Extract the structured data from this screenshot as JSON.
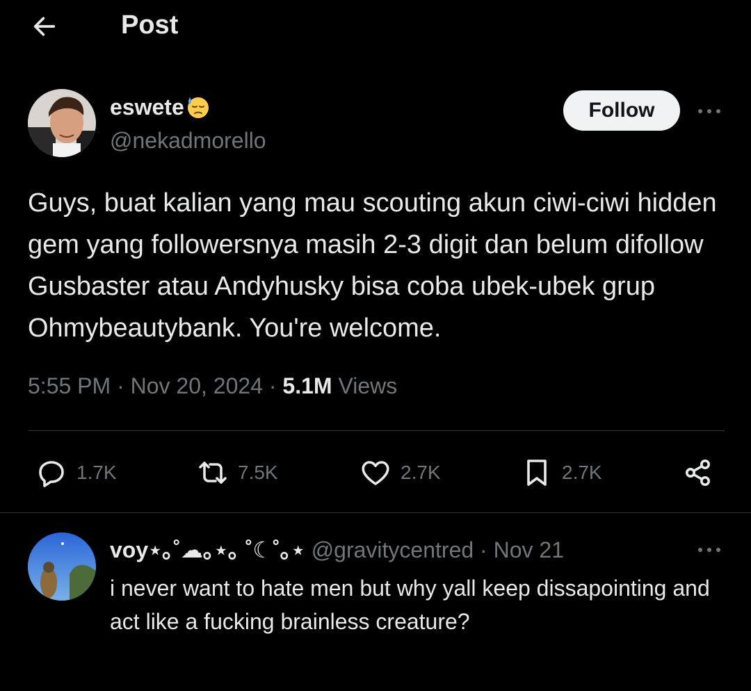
{
  "header": {
    "title": "Post"
  },
  "post": {
    "author_name": "eswete",
    "author_handle": "@nekadmorello",
    "follow_label": "Follow",
    "text": "Guys, buat kalian yang mau scouting akun ciwi-ciwi hidden gem yang followersnya masih 2-3 digit dan belum difollow Gusbaster atau Andyhusky bisa coba ubek-ubek grup Ohmybeautybank. You're welcome.",
    "time": "5:55 PM",
    "date": "Nov 20, 2024",
    "views_count": "5.1M",
    "views_label": "Views",
    "stats": {
      "replies": "1.7K",
      "reposts": "7.5K",
      "likes": "2.7K",
      "bookmarks": "2.7K"
    }
  },
  "reply": {
    "author_name": "voy⋆｡˚☁︎｡⋆｡ ˚☾˚｡⋆",
    "author_handle": "@gravitycentred",
    "date": "Nov 21",
    "text": "i never want to hate men but why yall keep dissapointing and act like a fucking brainless creature?"
  },
  "icons": {
    "back": "arrow-left-icon",
    "more": "more-horizontal-icon",
    "reply": "reply-icon",
    "repost": "repost-icon",
    "like": "heart-icon",
    "bookmark": "bookmark-icon",
    "share": "share-icon",
    "badge": "downcast-sweat-face-emoji"
  },
  "colors": {
    "background": "#000000",
    "text_primary": "#e7e9ea",
    "text_secondary": "#71767b",
    "follow_bg": "#eff3f4",
    "divider": "#2f3336"
  }
}
